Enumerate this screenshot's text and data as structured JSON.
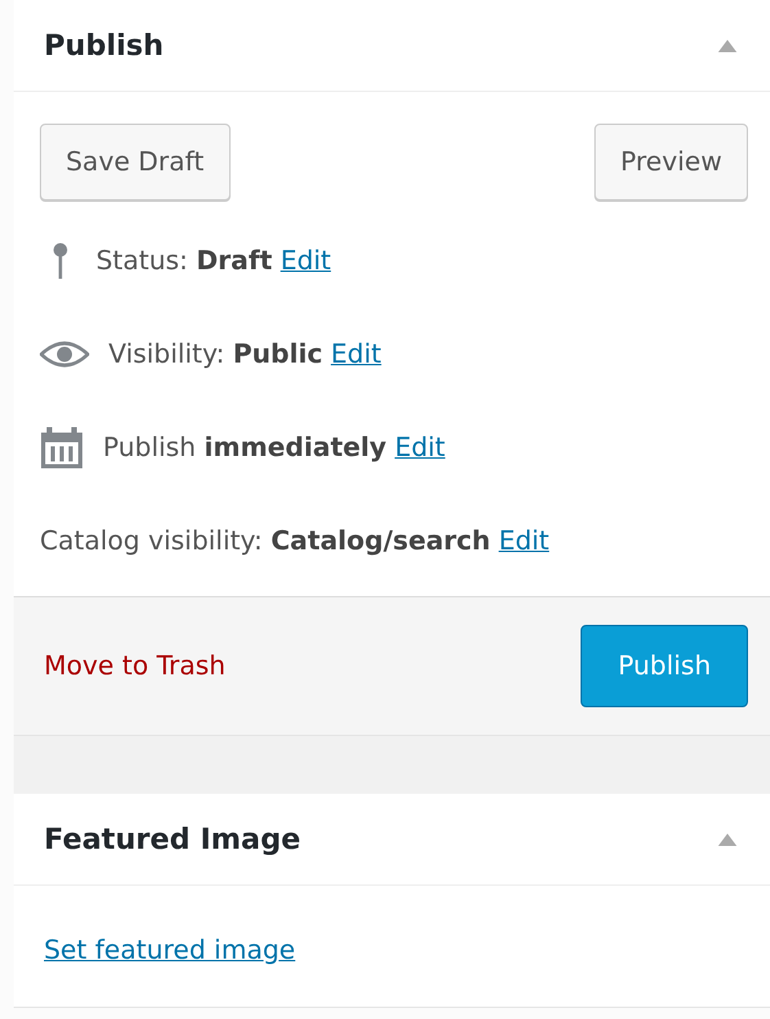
{
  "publish_box": {
    "title": "Publish",
    "collapsed": false,
    "save_draft_button": "Save Draft",
    "preview_button": "Preview",
    "rows": [
      {
        "kind": "pin",
        "label": "Status: **Draft**",
        "link": "Edit"
      },
      {
        "kind": "eye",
        "label": "Visibility: **Public**",
        "link": "Edit"
      },
      {
        "kind": "calendar",
        "label": "Publish **immediately**",
        "link": "Edit"
      },
      {
        "kind": "plain",
        "label": "Catalog visibility: **Catalog/search**",
        "link": "Edit"
      }
    ],
    "trash_link": "Move to Trash",
    "publish_button": "Publish"
  },
  "featured_image_box": {
    "title": "Featured Image",
    "collapsed": false,
    "link": "Set featured image"
  }
}
